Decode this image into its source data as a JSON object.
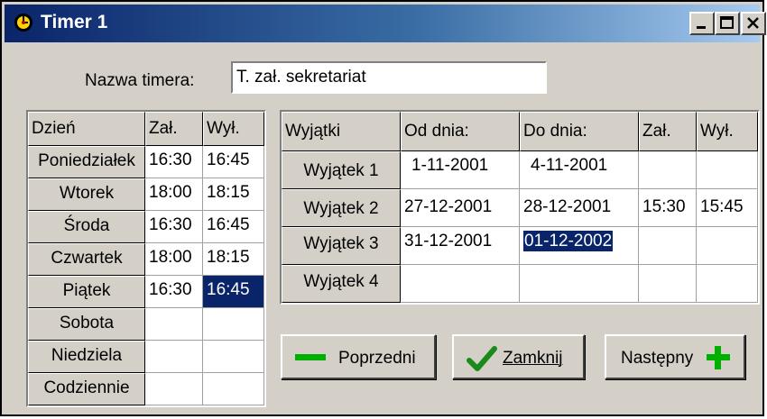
{
  "window": {
    "title": "Timer 1"
  },
  "name_field": {
    "label": "Nazwa timera:",
    "value": "T. zał. sekretariat"
  },
  "days_table": {
    "headers": [
      "Dzień",
      "Zał.",
      "Wył."
    ],
    "rows": [
      {
        "day": "Poniedziałek",
        "on": "16:30",
        "off": "16:45"
      },
      {
        "day": "Wtorek",
        "on": "18:00",
        "off": "18:15"
      },
      {
        "day": "Środa",
        "on": "16:30",
        "off": "16:45"
      },
      {
        "day": "Czwartek",
        "on": "18:00",
        "off": "18:15"
      },
      {
        "day": "Piątek",
        "on": "16:30",
        "off": "16:45"
      },
      {
        "day": "Sobota",
        "on": "",
        "off": ""
      },
      {
        "day": "Niedziela",
        "on": "",
        "off": ""
      },
      {
        "day": "Codziennie",
        "on": "",
        "off": ""
      }
    ]
  },
  "exceptions_table": {
    "headers": [
      "Wyjątki",
      "Od dnia:",
      "Do dnia:",
      "Zał.",
      "Wył."
    ],
    "rows": [
      {
        "name": "Wyjątek 1",
        "from": "1-11-2001",
        "to": "4-11-2001",
        "on": "",
        "off": ""
      },
      {
        "name": "Wyjątek 2",
        "from": "27-12-2001",
        "to": "28-12-2001",
        "on": "15:30",
        "off": "15:45"
      },
      {
        "name": "Wyjątek 3",
        "from": "31-12-2001",
        "to": "01-12-2002",
        "on": "",
        "off": ""
      },
      {
        "name": "Wyjątek 4",
        "from": "",
        "to": "",
        "on": "",
        "off": ""
      }
    ]
  },
  "buttons": {
    "previous": "Poprzedni",
    "close": "Zamknij",
    "next": "Następny"
  },
  "colors": {
    "selection": "#0a246a",
    "face": "#d4d0c8",
    "plus_minus_green": "#00b000",
    "check_green": "#1a8a1a"
  }
}
